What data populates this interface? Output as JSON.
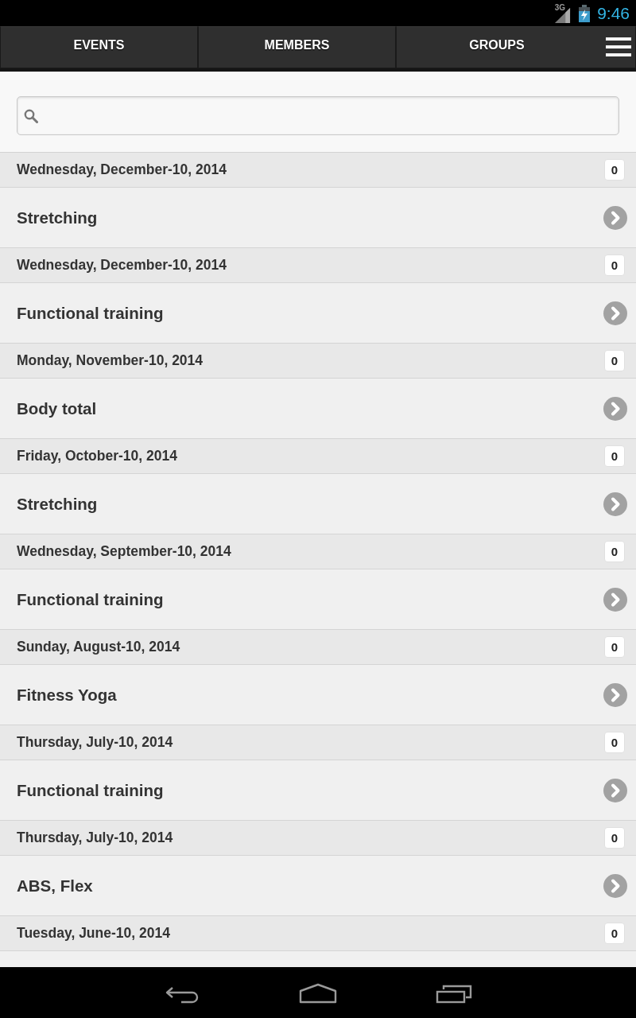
{
  "status_bar": {
    "network": "3G",
    "time": "9:46"
  },
  "tabs": [
    {
      "label": "EVENTS"
    },
    {
      "label": "MEMBERS"
    },
    {
      "label": "GROUPS"
    }
  ],
  "events": [
    {
      "date": "Wednesday, December-10, 2014",
      "count": "0",
      "title": "Stretching"
    },
    {
      "date": "Wednesday, December-10, 2014",
      "count": "0",
      "title": "Functional training"
    },
    {
      "date": "Monday, November-10, 2014",
      "count": "0",
      "title": "Body total"
    },
    {
      "date": "Friday, October-10, 2014",
      "count": "0",
      "title": "Stretching"
    },
    {
      "date": "Wednesday, September-10, 2014",
      "count": "0",
      "title": "Functional training"
    },
    {
      "date": "Sunday, August-10, 2014",
      "count": "0",
      "title": "Fitness Yoga"
    },
    {
      "date": "Thursday, July-10, 2014",
      "count": "0",
      "title": "Functional training"
    },
    {
      "date": "Thursday, July-10, 2014",
      "count": "0",
      "title": "ABS, Flex"
    },
    {
      "date": "Tuesday, June-10, 2014",
      "count": "0"
    }
  ]
}
